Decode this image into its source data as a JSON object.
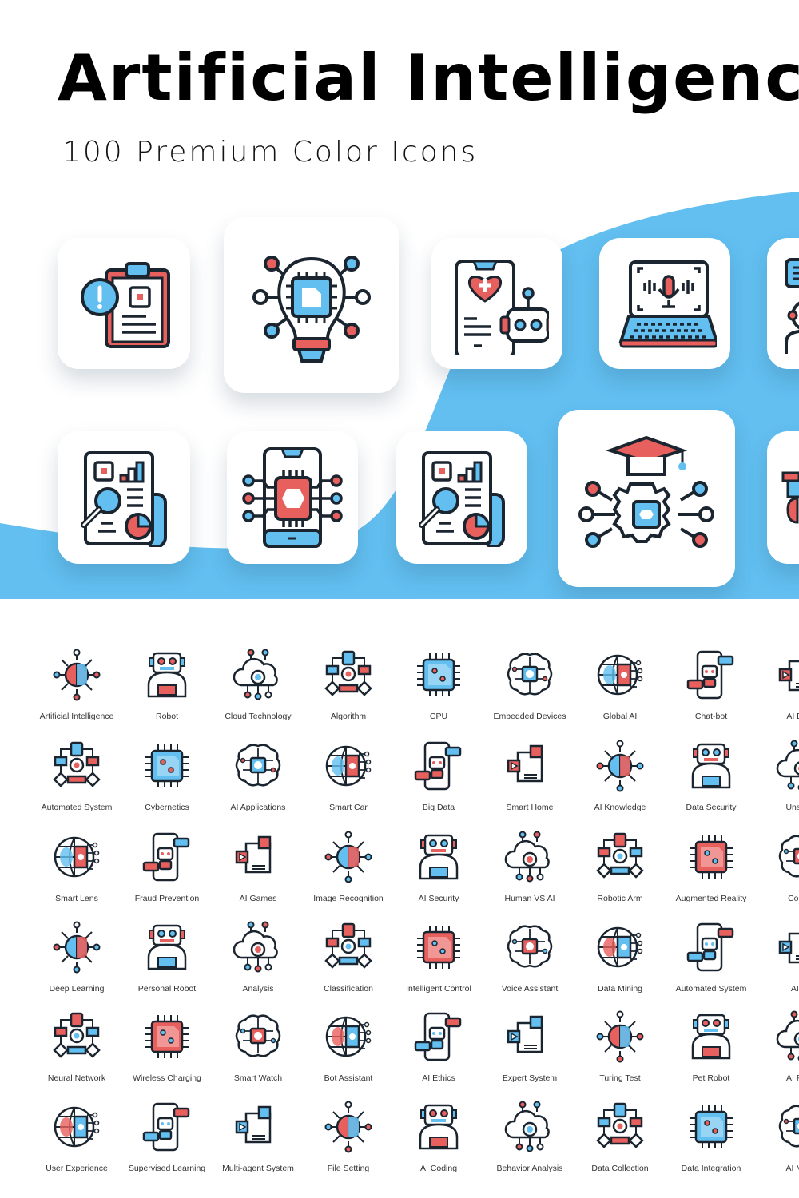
{
  "header": {
    "title": "Artificial Intelligence",
    "subtitle": "100 Premium Color Icons"
  },
  "colors": {
    "accent_blue": "#62BFF0",
    "accent_red": "#E8605E",
    "outline": "#1B2530",
    "background": "#FFFFFF"
  },
  "hero": {
    "tiles": [
      {
        "icon": "clipboard-chip-alert-icon"
      },
      {
        "icon": "lightbulb-chip-icon"
      },
      {
        "icon": "phone-health-robot-icon"
      },
      {
        "icon": "laptop-voice-icon"
      },
      {
        "icon": "chat-assistant-person-icon"
      },
      {
        "icon": "report-analysis-icon"
      },
      {
        "icon": "phone-chip-icon"
      },
      {
        "icon": "report-analysis-icon"
      },
      {
        "icon": "graduation-gear-chip-icon"
      },
      {
        "icon": "partial-robot-icon"
      }
    ]
  },
  "grid": {
    "rows": [
      [
        {
          "label": "Artificial Intelligence",
          "icon": "brain-circuit-icon"
        },
        {
          "label": "Robot",
          "icon": "robot-icon"
        },
        {
          "label": "Cloud Technology",
          "icon": "cloud-gear-icon"
        },
        {
          "label": "Algorithm",
          "icon": "flowchart-icon"
        },
        {
          "label": "CPU",
          "icon": "cpu-icon"
        },
        {
          "label": "Embedded Devices",
          "icon": "brain-chip-icon"
        },
        {
          "label": "Global AI",
          "icon": "globe-chip-icon"
        },
        {
          "label": "Chat-bot",
          "icon": "phone-chatbot-icon"
        },
        {
          "label": "AI Deve",
          "icon": "hand-gear-icon"
        }
      ],
      [
        {
          "label": "Automated System",
          "icon": "gear-network-icon"
        },
        {
          "label": "Cybernetics",
          "icon": "head-chip-icon"
        },
        {
          "label": "AI Applications",
          "icon": "phone-gear-icon"
        },
        {
          "label": "Smart Car",
          "icon": "car-wifi-icon"
        },
        {
          "label": "Big Data",
          "icon": "cloud-servers-icon"
        },
        {
          "label": "Smart Home",
          "icon": "house-wifi-icon"
        },
        {
          "label": "AI Knowledge",
          "icon": "book-chip-icon"
        },
        {
          "label": "Data Security",
          "icon": "cloud-shield-icon"
        },
        {
          "label": "Unstruct",
          "icon": "document-video-icon"
        }
      ],
      [
        {
          "label": "Smart Lens",
          "icon": "eye-chip-icon"
        },
        {
          "label": "Fraud Prevention",
          "icon": "shield-card-icon"
        },
        {
          "label": "AI Games",
          "icon": "gamepad-icon"
        },
        {
          "label": "Image Recognition",
          "icon": "monitor-image-icon"
        },
        {
          "label": "AI Security",
          "icon": "laptop-shield-icon"
        },
        {
          "label": "Human VS AI",
          "icon": "board-game-icon"
        },
        {
          "label": "Robotic Arm",
          "icon": "robotic-arm-icon"
        },
        {
          "label": "Augmented Reality",
          "icon": "phone-cube-icon"
        },
        {
          "label": "Compu",
          "icon": "eye-message-icon"
        }
      ],
      [
        {
          "label": "Deep Learning",
          "icon": "monitor-network-icon"
        },
        {
          "label": "Personal Robot",
          "icon": "personal-robot-icon"
        },
        {
          "label": "Analysis",
          "icon": "browser-chart-icon"
        },
        {
          "label": "Classification",
          "icon": "cloud-shapes-icon"
        },
        {
          "label": "Intelligent Control",
          "icon": "chip-sliders-icon"
        },
        {
          "label": "Voice Assistant",
          "icon": "phone-bot-voice-icon"
        },
        {
          "label": "Data Mining",
          "icon": "server-pickaxe-icon"
        },
        {
          "label": "Automated System",
          "icon": "gear-messages-icon"
        },
        {
          "label": "AI Re",
          "icon": "monitor-chip-icon"
        }
      ],
      [
        {
          "label": "Neural Network",
          "icon": "brain-nodes-icon"
        },
        {
          "label": "Wireless Charging",
          "icon": "phone-charging-icon"
        },
        {
          "label": "Smart Watch",
          "icon": "watch-heart-icon"
        },
        {
          "label": "Bot Assistant",
          "icon": "bot-laptop-icon"
        },
        {
          "label": "AI Ethics",
          "icon": "chip-scales-icon"
        },
        {
          "label": "Expert System",
          "icon": "server-graduation-icon"
        },
        {
          "label": "Turing Test",
          "icon": "robot-human-icon"
        },
        {
          "label": "Pet Robot",
          "icon": "robot-dog-icon"
        },
        {
          "label": "AI Perfo",
          "icon": "document-gauge-icon"
        }
      ],
      [
        {
          "label": "User Experience",
          "icon": "user-cycle-icon"
        },
        {
          "label": "Supervised Learning",
          "icon": "book-eye-icon"
        },
        {
          "label": "Multi-agent System",
          "icon": "cloud-laptops-icon"
        },
        {
          "label": "File Setting",
          "icon": "file-gear-icon"
        },
        {
          "label": "AI Coding",
          "icon": "browser-code-icon"
        },
        {
          "label": "Behavior Analysis",
          "icon": "monitor-brain-icon"
        },
        {
          "label": "Data Collection",
          "icon": "files-server-icon"
        },
        {
          "label": "Data Integration",
          "icon": "server-gear-icon"
        },
        {
          "label": "AI Mana",
          "icon": "laptop-robot-gear-icon"
        }
      ]
    ]
  }
}
